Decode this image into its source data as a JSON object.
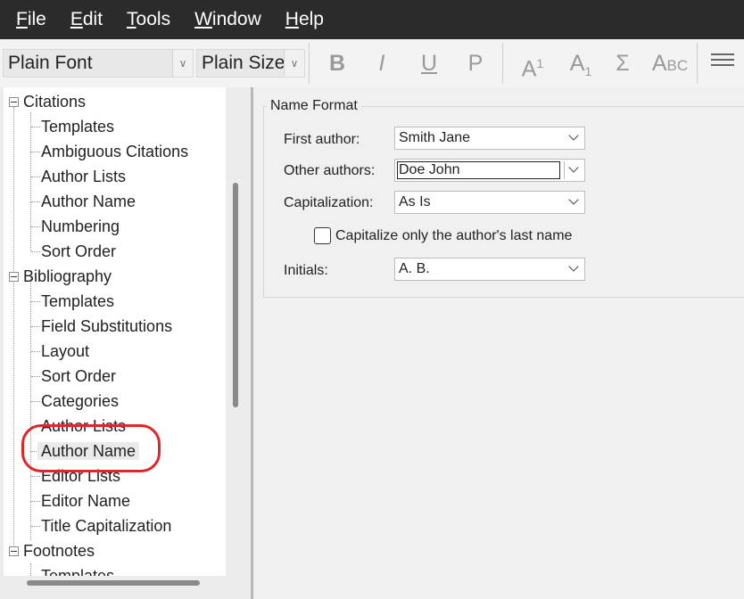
{
  "menu": [
    {
      "accel": "F",
      "rest": "ile"
    },
    {
      "accel": "E",
      "rest": "dit"
    },
    {
      "accel": "T",
      "rest": "ools"
    },
    {
      "accel": "W",
      "rest": "indow"
    },
    {
      "accel": "H",
      "rest": "elp"
    }
  ],
  "toolbar": {
    "font": "Plain Font",
    "size": "Plain Size",
    "bold": "B",
    "italic": "I",
    "underline": "U",
    "plain": "P",
    "superscript_base": "A",
    "superscript_mark": "1",
    "subscript_base": "A",
    "subscript_mark": "1",
    "sigma": "Σ",
    "smallcaps_big": "A",
    "smallcaps_small": "BC"
  },
  "tree": {
    "citations": {
      "label": "Citations",
      "children": [
        "Templates",
        "Ambiguous Citations",
        "Author Lists",
        "Author Name",
        "Numbering",
        "Sort Order"
      ]
    },
    "bibliography": {
      "label": "Bibliography",
      "children": [
        "Templates",
        "Field Substitutions",
        "Layout",
        "Sort Order",
        "Categories",
        "Author Lists",
        "Author Name",
        "Editor Lists",
        "Editor Name",
        "Title Capitalization"
      ]
    },
    "footnotes": {
      "label": "Footnotes",
      "children": [
        "Templates"
      ]
    }
  },
  "name_format": {
    "title": "Name Format",
    "first_author_label": "First author:",
    "first_author_value": "Smith Jane",
    "other_authors_label": "Other authors:",
    "other_authors_value": "Doe John",
    "capitalization_label": "Capitalization:",
    "capitalization_value": "As Is",
    "capitalize_last_label": "Capitalize only the author's last name",
    "capitalize_last_checked": false,
    "initials_label": "Initials:",
    "initials_value": "A. B."
  },
  "colors": {
    "menubar": "#2b2b2b",
    "highlight_oval": "#e0262a"
  }
}
